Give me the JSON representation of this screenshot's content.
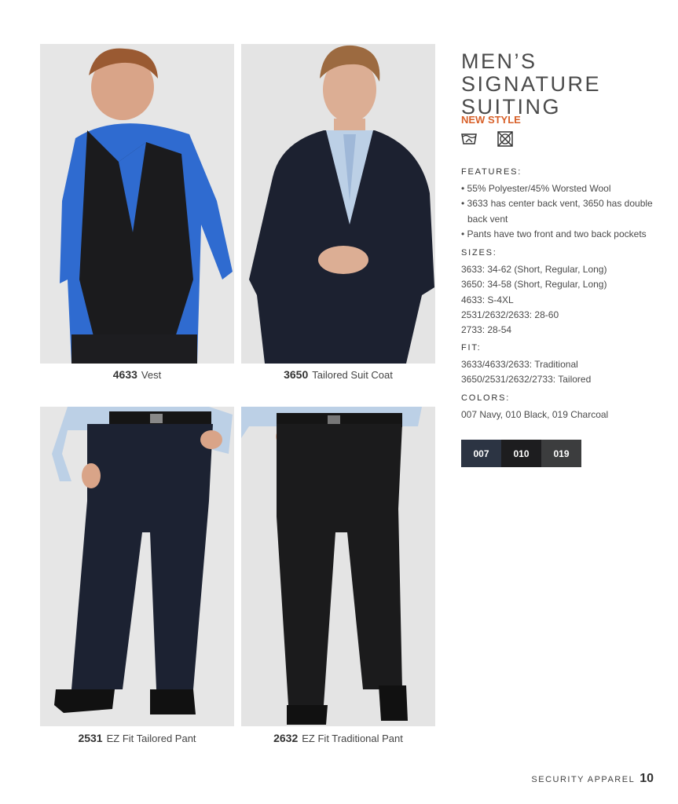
{
  "products": [
    {
      "code": "4633",
      "name": "Vest"
    },
    {
      "code": "3650",
      "name": "Tailored Suit Coat"
    },
    {
      "code": "2531",
      "name": "EZ Fit Tailored Pant"
    },
    {
      "code": "2632",
      "name": "EZ Fit Traditional Pant"
    }
  ],
  "title": "MEN’S SIGNATURE SUITING",
  "new_style": "NEW STYLE",
  "care_icons": [
    "hand-wash-icon",
    "do-not-tumble-dry-icon"
  ],
  "features": {
    "heading": "FEATURES:",
    "items": [
      "• 55% Polyester/45% Worsted Wool",
      "• 3633 has center back vent, 3650 has double back vent",
      "• Pants have two front and two back pockets"
    ]
  },
  "sizes": {
    "heading": "SIZES:",
    "items": [
      "3633: 34-62 (Short, Regular, Long)",
      "3650: 34-58 (Short, Regular, Long)",
      "4633: S-4XL",
      "2531/2632/2633: 28-60",
      "2733: 28-54"
    ]
  },
  "fit": {
    "heading": "FIT:",
    "items": [
      "3633/4633/2633: Traditional",
      "3650/2531/2632/2733: Tailored"
    ]
  },
  "colors": {
    "heading": "COLORS:",
    "text": "007 Navy, 010 Black, 019 Charcoal",
    "swatches": [
      {
        "code": "007",
        "color": "#2c3443"
      },
      {
        "code": "010",
        "color": "#1d1d1f"
      },
      {
        "code": "019",
        "color": "#3c3d3e"
      }
    ]
  },
  "footer": {
    "section": "SECURITY APPAREL",
    "page": "10"
  }
}
